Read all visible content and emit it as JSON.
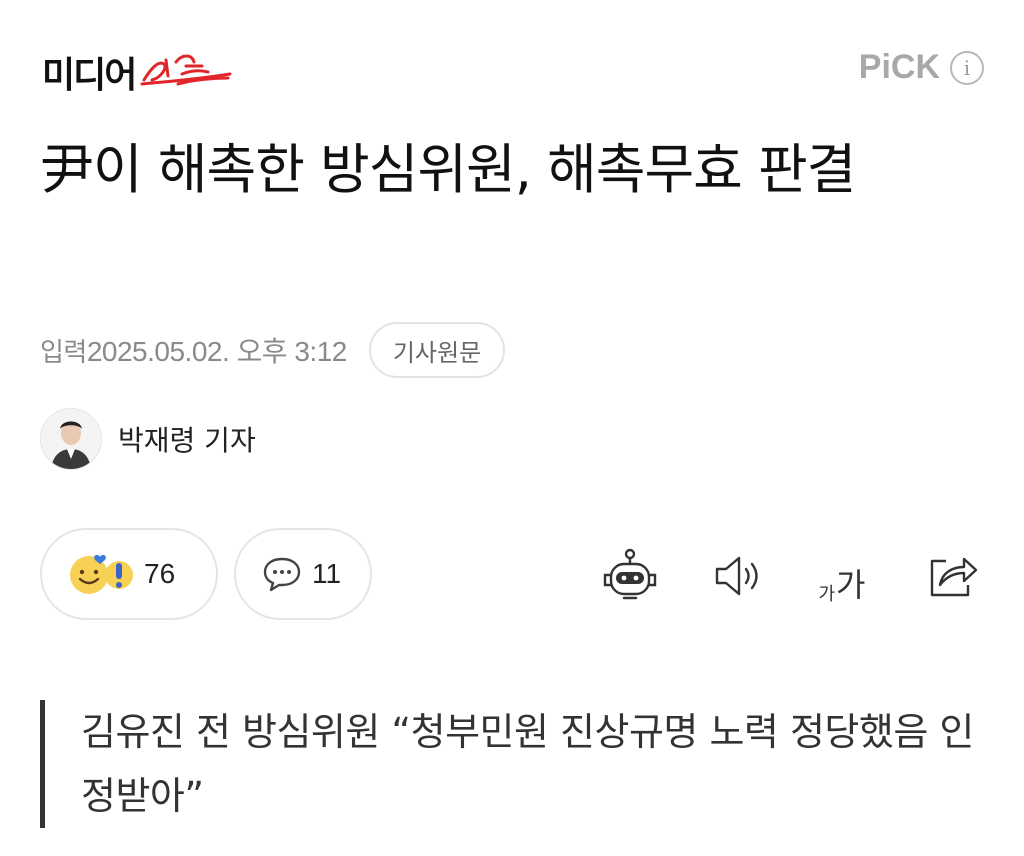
{
  "header": {
    "logo_main": "미디어",
    "logo_script": "오늘",
    "pick_label": "PiCK",
    "info_label": "i"
  },
  "article": {
    "title": "尹이 해촉한 방심위원, 해촉무효 판결",
    "date_label": "입력",
    "date_value": "2025.05.02. 오후 3:12",
    "original_button": "기사원문",
    "author": "박재령 기자",
    "summary": "김유진 전 방심위원 “청부민원 진상규명 노력 정당했음 인정받아”"
  },
  "actions": {
    "reaction_count": "76",
    "comment_count": "11",
    "font_small": "가",
    "font_big": "가"
  },
  "colors": {
    "accent_red": "#e0262a",
    "muted_gray": "#8a8a8a",
    "border_gray": "#e5e5e5"
  },
  "icons": [
    "smile-icon",
    "heart-icon",
    "exclaim-icon",
    "comment-icon",
    "robot-icon",
    "speaker-icon",
    "font-size-icon",
    "share-icon"
  ]
}
